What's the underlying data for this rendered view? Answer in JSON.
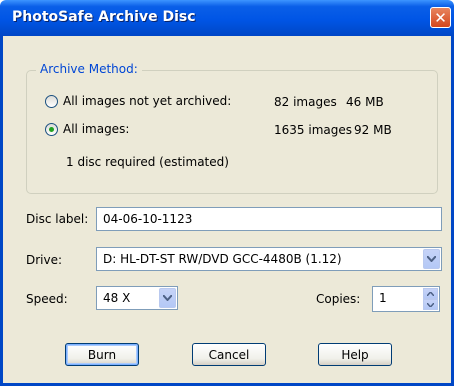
{
  "window": {
    "title": "PhotoSafe Archive Disc",
    "close_symbol": "✕"
  },
  "archive_method": {
    "legend": "Archive Method:",
    "options": [
      {
        "label": "All images not yet archived:",
        "count": "82 images",
        "size": "46 MB",
        "selected": false
      },
      {
        "label": "All images:",
        "count": "1635 images",
        "size": "92 MB",
        "selected": true
      }
    ],
    "estimate": "1 disc required (estimated)"
  },
  "disc_label": {
    "label": "Disc label:",
    "value": "04-06-10-1123"
  },
  "drive": {
    "label": "Drive:",
    "value": "D: HL-DT-ST RW/DVD GCC-4480B (1.12)"
  },
  "speed": {
    "label": "Speed:",
    "value": "48 X"
  },
  "copies": {
    "label": "Copies:",
    "value": "1"
  },
  "buttons": {
    "burn": "Burn",
    "cancel": "Cancel",
    "help": "Help"
  },
  "colors": {
    "title_bar": "#0055e5",
    "dialog_bg": "#ece9d8",
    "legend_text": "#0046d5",
    "radio_dot": "#21a121",
    "close_button": "#d5461c"
  }
}
